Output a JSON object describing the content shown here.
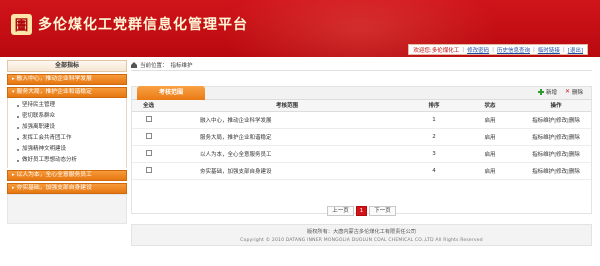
{
  "header": {
    "logo_char": "圕",
    "title": "多伦煤化工党群信息化管理平台"
  },
  "userbar": {
    "welcome": "欢迎您:多伦煤化工",
    "links": [
      "修改密码",
      "历史信息查询",
      "临时链接",
      "[退出]"
    ]
  },
  "sidebar": {
    "title": "全部指标",
    "groups": [
      {
        "label": "融入中心，推动企业科学发展",
        "expanded": false,
        "items": []
      },
      {
        "label": "服务大局，推护企业和谐稳定",
        "expanded": true,
        "items": [
          "坚持民主管理",
          "密切联系群众",
          "加强离职建设",
          "发挥工会共青团工作",
          "加强精神文明建设",
          "做好员工思想动态分析"
        ]
      },
      {
        "label": "以人为本，全心全意服务员工",
        "expanded": false,
        "items": []
      },
      {
        "label": "夯实基础，加强支部自身建设",
        "expanded": false,
        "items": []
      }
    ]
  },
  "breadcrumb": {
    "prefix": "当前位置：",
    "current": "指标维护"
  },
  "panel": {
    "tab": "考核范围",
    "add_label": "新增",
    "delete_label": "删除",
    "columns": {
      "check": "全选",
      "name": "考核范围",
      "order": "排序",
      "status": "状态",
      "ops": "操作"
    },
    "rows": [
      {
        "name": "融入中心，推动企业科学发展",
        "order": "1",
        "status": "启用",
        "ops": "指标维护|修改|删除"
      },
      {
        "name": "服务大局，推护企业和谐稳定",
        "order": "2",
        "status": "启用",
        "ops": "指标维护|修改|删除"
      },
      {
        "name": "以人为本，全心全意服务员工",
        "order": "3",
        "status": "启用",
        "ops": "指标维护|修改|删除"
      },
      {
        "name": "夯实基础，加强支部自身建设",
        "order": "4",
        "status": "启用",
        "ops": "指标维护|修改|删除"
      }
    ]
  },
  "pager": {
    "prev": "上一页",
    "current": "1",
    "next": "下一页"
  },
  "footer": {
    "line1": "版权所有：大唐内蒙古多伦煤化工有限责任公司",
    "line2": "Copyright © 2010 DATANG INNER MONGOLIA DUOLUN COAL CHEMICAL CO.,LTD All Rights Reserved"
  }
}
